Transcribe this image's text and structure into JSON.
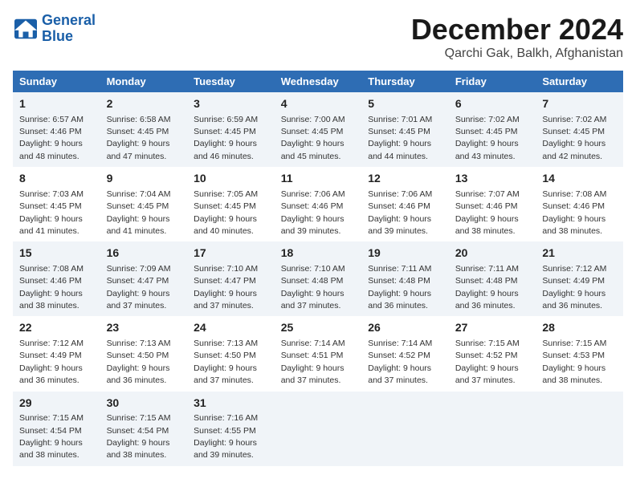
{
  "logo": {
    "line1": "General",
    "line2": "Blue"
  },
  "title": "December 2024",
  "subtitle": "Qarchi Gak, Balkh, Afghanistan",
  "days_header": [
    "Sunday",
    "Monday",
    "Tuesday",
    "Wednesday",
    "Thursday",
    "Friday",
    "Saturday"
  ],
  "weeks": [
    [
      {
        "day": "1",
        "sunrise": "6:57 AM",
        "sunset": "4:46 PM",
        "daylight": "9 hours and 48 minutes."
      },
      {
        "day": "2",
        "sunrise": "6:58 AM",
        "sunset": "4:45 PM",
        "daylight": "9 hours and 47 minutes."
      },
      {
        "day": "3",
        "sunrise": "6:59 AM",
        "sunset": "4:45 PM",
        "daylight": "9 hours and 46 minutes."
      },
      {
        "day": "4",
        "sunrise": "7:00 AM",
        "sunset": "4:45 PM",
        "daylight": "9 hours and 45 minutes."
      },
      {
        "day": "5",
        "sunrise": "7:01 AM",
        "sunset": "4:45 PM",
        "daylight": "9 hours and 44 minutes."
      },
      {
        "day": "6",
        "sunrise": "7:02 AM",
        "sunset": "4:45 PM",
        "daylight": "9 hours and 43 minutes."
      },
      {
        "day": "7",
        "sunrise": "7:02 AM",
        "sunset": "4:45 PM",
        "daylight": "9 hours and 42 minutes."
      }
    ],
    [
      {
        "day": "8",
        "sunrise": "7:03 AM",
        "sunset": "4:45 PM",
        "daylight": "9 hours and 41 minutes."
      },
      {
        "day": "9",
        "sunrise": "7:04 AM",
        "sunset": "4:45 PM",
        "daylight": "9 hours and 41 minutes."
      },
      {
        "day": "10",
        "sunrise": "7:05 AM",
        "sunset": "4:45 PM",
        "daylight": "9 hours and 40 minutes."
      },
      {
        "day": "11",
        "sunrise": "7:06 AM",
        "sunset": "4:46 PM",
        "daylight": "9 hours and 39 minutes."
      },
      {
        "day": "12",
        "sunrise": "7:06 AM",
        "sunset": "4:46 PM",
        "daylight": "9 hours and 39 minutes."
      },
      {
        "day": "13",
        "sunrise": "7:07 AM",
        "sunset": "4:46 PM",
        "daylight": "9 hours and 38 minutes."
      },
      {
        "day": "14",
        "sunrise": "7:08 AM",
        "sunset": "4:46 PM",
        "daylight": "9 hours and 38 minutes."
      }
    ],
    [
      {
        "day": "15",
        "sunrise": "7:08 AM",
        "sunset": "4:46 PM",
        "daylight": "9 hours and 38 minutes."
      },
      {
        "day": "16",
        "sunrise": "7:09 AM",
        "sunset": "4:47 PM",
        "daylight": "9 hours and 37 minutes."
      },
      {
        "day": "17",
        "sunrise": "7:10 AM",
        "sunset": "4:47 PM",
        "daylight": "9 hours and 37 minutes."
      },
      {
        "day": "18",
        "sunrise": "7:10 AM",
        "sunset": "4:48 PM",
        "daylight": "9 hours and 37 minutes."
      },
      {
        "day": "19",
        "sunrise": "7:11 AM",
        "sunset": "4:48 PM",
        "daylight": "9 hours and 36 minutes."
      },
      {
        "day": "20",
        "sunrise": "7:11 AM",
        "sunset": "4:48 PM",
        "daylight": "9 hours and 36 minutes."
      },
      {
        "day": "21",
        "sunrise": "7:12 AM",
        "sunset": "4:49 PM",
        "daylight": "9 hours and 36 minutes."
      }
    ],
    [
      {
        "day": "22",
        "sunrise": "7:12 AM",
        "sunset": "4:49 PM",
        "daylight": "9 hours and 36 minutes."
      },
      {
        "day": "23",
        "sunrise": "7:13 AM",
        "sunset": "4:50 PM",
        "daylight": "9 hours and 36 minutes."
      },
      {
        "day": "24",
        "sunrise": "7:13 AM",
        "sunset": "4:50 PM",
        "daylight": "9 hours and 37 minutes."
      },
      {
        "day": "25",
        "sunrise": "7:14 AM",
        "sunset": "4:51 PM",
        "daylight": "9 hours and 37 minutes."
      },
      {
        "day": "26",
        "sunrise": "7:14 AM",
        "sunset": "4:52 PM",
        "daylight": "9 hours and 37 minutes."
      },
      {
        "day": "27",
        "sunrise": "7:15 AM",
        "sunset": "4:52 PM",
        "daylight": "9 hours and 37 minutes."
      },
      {
        "day": "28",
        "sunrise": "7:15 AM",
        "sunset": "4:53 PM",
        "daylight": "9 hours and 38 minutes."
      }
    ],
    [
      {
        "day": "29",
        "sunrise": "7:15 AM",
        "sunset": "4:54 PM",
        "daylight": "9 hours and 38 minutes."
      },
      {
        "day": "30",
        "sunrise": "7:15 AM",
        "sunset": "4:54 PM",
        "daylight": "9 hours and 38 minutes."
      },
      {
        "day": "31",
        "sunrise": "7:16 AM",
        "sunset": "4:55 PM",
        "daylight": "9 hours and 39 minutes."
      },
      null,
      null,
      null,
      null
    ]
  ]
}
